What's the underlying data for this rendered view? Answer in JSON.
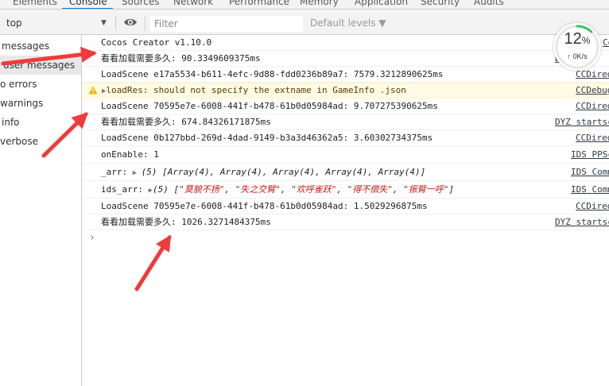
{
  "tabs": [
    "Elements",
    "Console",
    "Sources",
    "Network",
    "Performance",
    "Memory",
    "Application",
    "Security",
    "Audits"
  ],
  "toolbar": {
    "context": "top",
    "filter_placeholder": "Filter",
    "levels": "Default levels ▼"
  },
  "sidebar": {
    "items": [
      "messages",
      "user messages",
      "o errors",
      "warnings",
      "info",
      "verbose"
    ]
  },
  "console": {
    "rows": [
      {
        "text": "Cocos Creator v1.10.0",
        "source": "Coco"
      },
      {
        "text": "看看加载需要多久: 90.3349609375ms",
        "source": "DYZ"
      },
      {
        "text": "LoadScene e17a5534-b611-4efc-9d88-fdd0236b89a7: 7579.3212890625ms",
        "source": "CCDired"
      },
      {
        "text": "loadRes: should not specify the extname in GameInfo .json",
        "source": "CCDebug"
      },
      {
        "text": "LoadScene 70595e7e-6008-441f-b478-61b0d05984ad: 9.707275390625ms",
        "source": "CCDired"
      },
      {
        "text": "看看加载需要多久: 674.84326171875ms",
        "source": "DYZ startsc"
      },
      {
        "text": "LoadScene 0b127bbd-269d-4dad-9149-b3a3d46362a5: 3.60302734375ms",
        "source": "CCDired"
      },
      {
        "text": "onEnable:  1",
        "source": "IDS PPSc"
      },
      {
        "label": "_arr:  ",
        "text": "(5) [Array(4), Array(4), Array(4), Array(4), Array(4)]",
        "source": "IDS Comm"
      },
      {
        "label": "ids_arr:  ",
        "count": "(5) [",
        "items": [
          "\"莫貌不扬\"",
          "\"失之交臂\"",
          "\"欢呼雀跃\"",
          "\"得不偿失\"",
          "\"振臂一呼\""
        ],
        "end": "]",
        "source": "IDS Comm"
      },
      {
        "text": "LoadScene 70595e7e-6008-441f-b478-61b0d05984ad: 1.5029296875ms",
        "source": "CCDired"
      },
      {
        "text": "看看加载需要多久: 1026.3271484375ms",
        "source": "DYZ startsc"
      }
    ],
    "prompt": "›"
  },
  "perf": {
    "percent": "12",
    "percent_unit": "%",
    "speed": "0K/s",
    "ring_fraction": 0.12
  },
  "colors": {
    "arrow": "#ef3b3b",
    "accent": "#1a73e8",
    "ring": "#35c46a"
  }
}
